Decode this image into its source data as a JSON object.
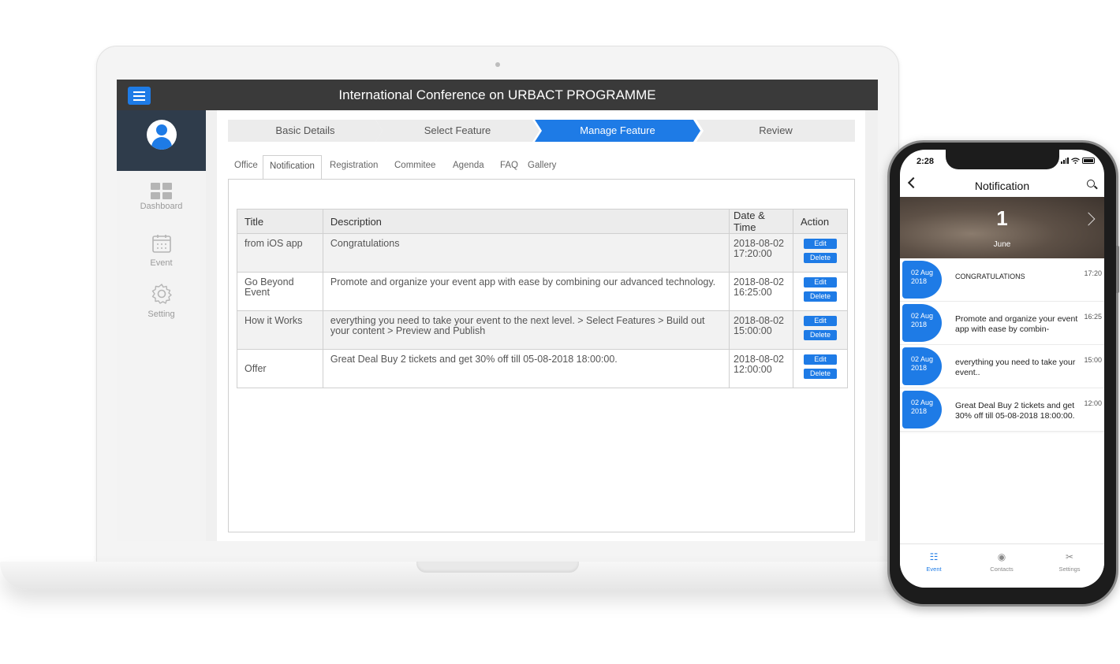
{
  "laptop": {
    "app_title": "International Conference on URBACT PROGRAMME",
    "sidebar": {
      "items": [
        {
          "label": "Dashboard",
          "icon": "dashboard-icon"
        },
        {
          "label": "Event",
          "icon": "calendar-icon"
        },
        {
          "label": "Setting",
          "icon": "gear-icon"
        }
      ]
    },
    "steps": [
      {
        "label": "Basic Details",
        "active": false
      },
      {
        "label": "Select Feature",
        "active": false
      },
      {
        "label": "Manage Feature",
        "active": true
      },
      {
        "label": "Review",
        "active": false
      }
    ],
    "tabs": [
      "Office",
      "Notification",
      "Registration",
      "Commitee",
      "Agenda",
      "FAQ",
      "Gallery"
    ],
    "active_tab": "Notification",
    "table": {
      "headers": [
        "Title",
        "Description",
        "Date & Time",
        "Action"
      ],
      "rows": [
        {
          "title": "from iOS app",
          "description": "Congratulations",
          "date": "2018-08-02",
          "time": "17:20:00"
        },
        {
          "title": "Go Beyond Event",
          "description": "Promote and organize your event app with ease by combining our advanced technology.",
          "date": "2018-08-02",
          "time": "16:25:00"
        },
        {
          "title": "How it Works",
          "description": "everything you need to take your event to the next level. > Select Features > Build out your content > Preview and Publish",
          "date": "2018-08-02",
          "time": "15:00:00"
        },
        {
          "title": "Offer",
          "description": "Great Deal Buy 2 tickets and get 30% off till 05-08-2018 18:00:00.",
          "date": "2018-08-02",
          "time": "12:00:00"
        }
      ],
      "edit_label": "Edit",
      "delete_label": "Delete"
    }
  },
  "phone": {
    "status_time": "2:28",
    "title": "Notification",
    "banner": {
      "day": "1",
      "month": "June"
    },
    "items": [
      {
        "date_line1": "02 Aug",
        "date_line2": "2018",
        "text": "CONGRATULATIONS",
        "time": "17:20"
      },
      {
        "date_line1": "02 Aug",
        "date_line2": "2018",
        "text": "Promote and organize your event app with ease by combin-",
        "time": "16:25"
      },
      {
        "date_line1": "02 Aug",
        "date_line2": "2018",
        "text": "everything you need to take your event..",
        "time": "15:00"
      },
      {
        "date_line1": "02 Aug",
        "date_line2": "2018",
        "text": "Great Deal Buy 2 tickets and get 30% off till 05-08-2018 18:00:00.",
        "time": "12:00"
      }
    ],
    "tabbar": [
      {
        "label": "Event",
        "icon": "event-icon",
        "active": true
      },
      {
        "label": "Contacts",
        "icon": "contacts-icon",
        "active": false
      },
      {
        "label": "Settings",
        "icon": "settings-icon",
        "active": false
      }
    ]
  },
  "colors": {
    "accent": "#1e7be6",
    "header_dark": "#3a3a3a",
    "profile_panel": "#2f3c4b"
  }
}
